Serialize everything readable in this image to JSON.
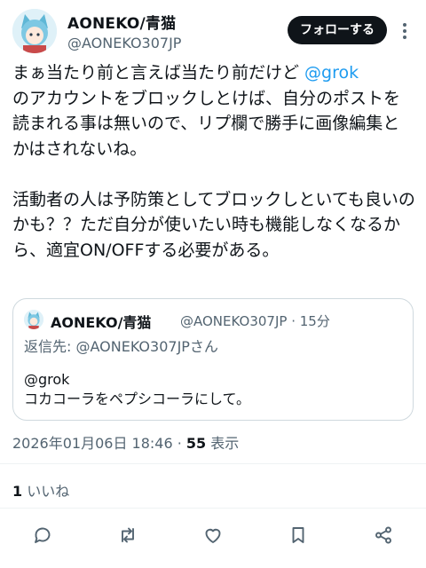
{
  "author": {
    "display_name": "AONEKO/青猫",
    "handle": "@AONEKO307JP",
    "avatar_icon": "cat-avatar-icon"
  },
  "follow_label": "フォローする",
  "post": {
    "text_before_mention": "まぁ当たり前と言えば当たり前だけど ",
    "mention": "@grok",
    "text_after_mention": "\nのアカウントをブロックしとけば、自分のポストを読まれる事は無いので、リプ欄で勝手に画像編集とかはされないね。\n\n活動者の人は予防策としてブロックしといても良いのかも？？ただ自分が使いたい時も機能しなくなるから、適宜ON/OFFする必要がある。"
  },
  "quote": {
    "display_name": "AONEKO/青猫",
    "meta": "@AONEKO307JP · 15分",
    "reply_to": "返信先: @AONEKO307JPさん",
    "text": "@grok\nコカコーラをペプシコーラにして。"
  },
  "timestamp": {
    "date": "2026年01月06日 18:46 · ",
    "views_count": "55",
    "views_label": " 表示"
  },
  "likes": {
    "count": "1",
    "label": " いいね"
  },
  "colors": {
    "accent": "#1d9bf0",
    "text": "#0f1419",
    "muted": "#536471",
    "button_bg": "#0f1419"
  },
  "action_icons": [
    "reply-icon",
    "repost-icon",
    "like-icon",
    "bookmark-icon",
    "share-icon"
  ]
}
